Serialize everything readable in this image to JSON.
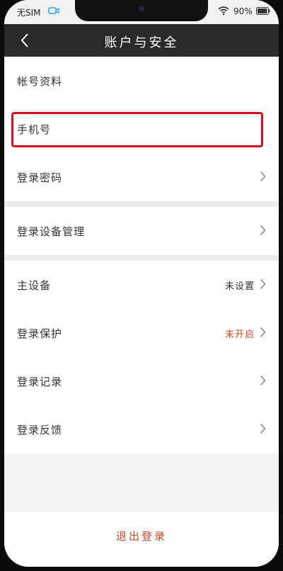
{
  "status_bar": {
    "carrier": "无SIM",
    "battery": "90%"
  },
  "nav": {
    "title": "账户与安全",
    "back_icon": "chevron-left-icon"
  },
  "rows": {
    "account_info": {
      "label": "帐号资料"
    },
    "phone": {
      "label": "手机号"
    },
    "password": {
      "label": "登录密码"
    },
    "device_mgmt": {
      "label": "登录设备管理"
    },
    "main_device": {
      "label": "主设备",
      "value": "未设置"
    },
    "login_protect": {
      "label": "登录保护",
      "value": "未开启"
    },
    "login_record": {
      "label": "登录记录"
    },
    "login_feedback": {
      "label": "登录反馈"
    }
  },
  "logout": {
    "label": "退出登录"
  },
  "colors": {
    "nav_bg": "#2a2a2a",
    "highlight": "#d8101e",
    "accent": "#c74a2c"
  }
}
